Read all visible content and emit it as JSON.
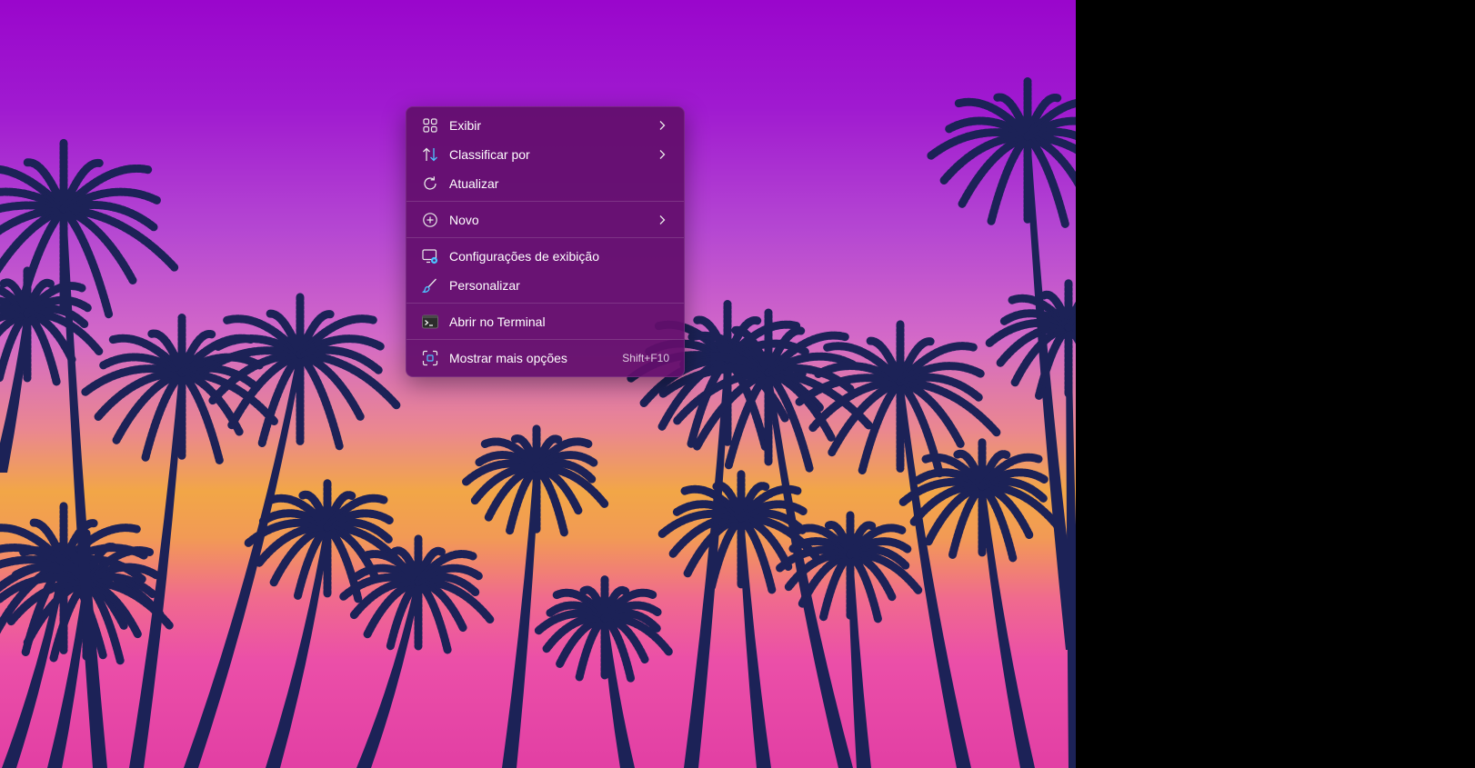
{
  "desktop": {
    "wallpaper": "palm-trees-sunset-wallpaper"
  },
  "context_menu": {
    "groups": [
      [
        {
          "label": "Exibir",
          "icon": "view-grid-icon",
          "submenu": true
        },
        {
          "label": "Classificar por",
          "icon": "sort-icon",
          "submenu": true
        },
        {
          "label": "Atualizar",
          "icon": "refresh-icon",
          "submenu": false
        }
      ],
      [
        {
          "label": "Novo",
          "icon": "new-plus-icon",
          "submenu": true
        }
      ],
      [
        {
          "label": "Configurações de exibição",
          "icon": "display-settings-icon",
          "submenu": false
        },
        {
          "label": "Personalizar",
          "icon": "personalize-brush-icon",
          "submenu": false
        }
      ],
      [
        {
          "label": "Abrir no Terminal",
          "icon": "terminal-icon",
          "submenu": false
        }
      ],
      [
        {
          "label": "Mostrar mais opções",
          "icon": "more-options-icon",
          "submenu": false,
          "shortcut": "Shift+F10"
        }
      ]
    ]
  },
  "colors": {
    "menu_background": "#620e6c",
    "menu_text": "#ffffff",
    "accent_blue": "#4cc2ff",
    "palm_silhouette": "#1c2257"
  }
}
